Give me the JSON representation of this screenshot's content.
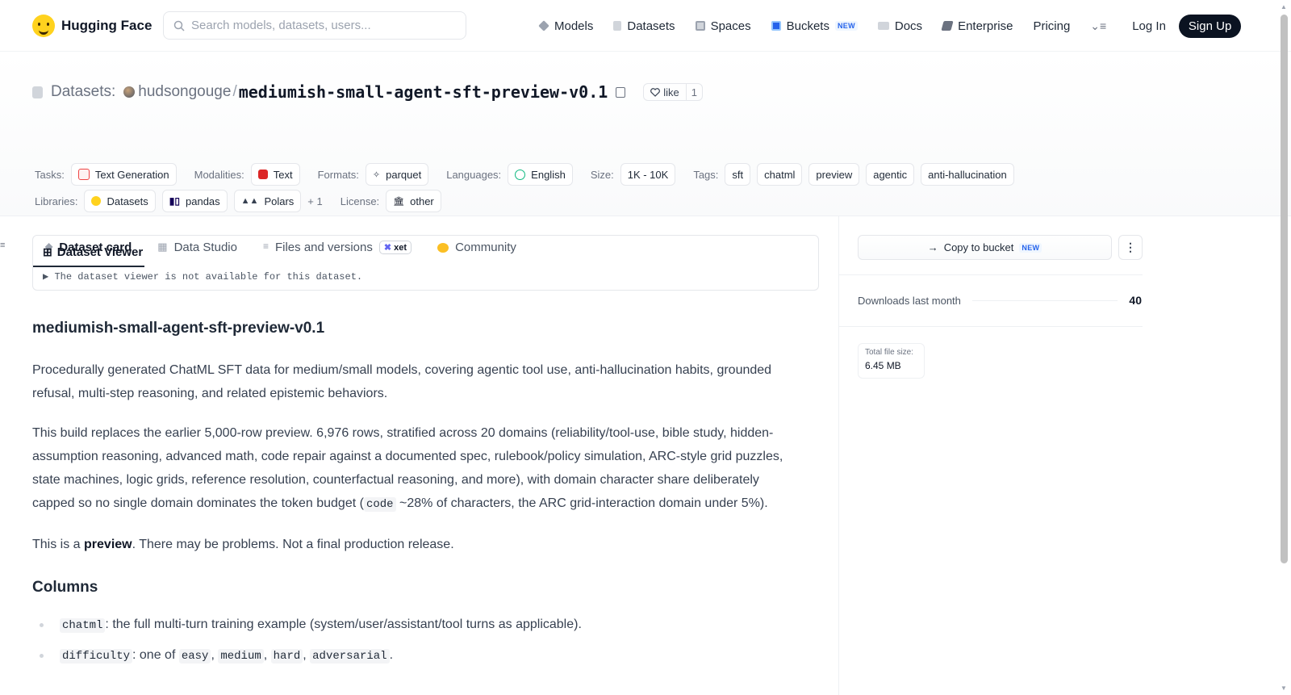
{
  "header": {
    "brand": "Hugging Face",
    "search_placeholder": "Search models, datasets, users...",
    "nav": [
      {
        "label": "Models",
        "icon": "cube-icon"
      },
      {
        "label": "Datasets",
        "icon": "database-icon"
      },
      {
        "label": "Spaces",
        "icon": "grid-icon"
      },
      {
        "label": "Buckets",
        "icon": "bucket-icon",
        "badge": "NEW"
      },
      {
        "label": "Docs",
        "icon": "book-icon"
      },
      {
        "label": "Enterprise",
        "icon": "enterprise-icon"
      },
      {
        "label": "Pricing"
      }
    ],
    "login": "Log In",
    "signup": "Sign Up"
  },
  "dataset": {
    "section": "Datasets:",
    "owner": "hudsongouge",
    "slash": "/",
    "name": "mediumish-small-agent-sft-preview-v0.1",
    "like_label": "like",
    "like_count": "1"
  },
  "meta": {
    "tasks_label": "Tasks:",
    "task": "Text Generation",
    "modalities_label": "Modalities:",
    "modality": "Text",
    "formats_label": "Formats:",
    "format": "parquet",
    "languages_label": "Languages:",
    "language": "English",
    "size_label": "Size:",
    "size": "1K - 10K",
    "tags_label": "Tags:",
    "tags": [
      "sft",
      "chatml",
      "preview",
      "agentic",
      "anti-hallucination"
    ],
    "libraries_label": "Libraries:",
    "libraries": [
      "Datasets",
      "pandas",
      "Polars"
    ],
    "libraries_more": "+ 1",
    "license_label": "License:",
    "license": "other"
  },
  "tabs": [
    {
      "label": "Dataset card",
      "active": true
    },
    {
      "label": "Data Studio"
    },
    {
      "label": "Files and versions",
      "badge": "xet"
    },
    {
      "label": "Community"
    }
  ],
  "viewer": {
    "title": "Dataset Viewer",
    "message": "The dataset viewer is not available for this dataset."
  },
  "card": {
    "title": "mediumish-small-agent-sft-preview-v0.1",
    "p1": "Procedurally generated ChatML SFT data for medium/small models, covering agentic tool use, anti-hallucination habits, grounded refusal, multi-step reasoning, and related epistemic behaviors.",
    "p2_before": "This build replaces the earlier 5,000-row preview. 6,976 rows, stratified across 20 domains (reliability/tool-use, bible study, hidden-assumption reasoning, advanced math, code repair against a documented spec, rulebook/policy simulation, ARC-style grid puzzles, state machines, logic grids, reference resolution, counterfactual reasoning, and more), with domain character share deliberately capped so no single domain dominates the token budget (",
    "p2_code": "code",
    "p2_after": " ~28% of characters, the ARC grid-interaction domain under 5%).",
    "p3_before": "This is a ",
    "p3_bold": "preview",
    "p3_after": ". There may be problems. Not a final production release.",
    "columns_title": "Columns",
    "col1_code": "chatml",
    "col1_text": ": the full multi-turn training example (system/user/assistant/tool turns as applicable).",
    "col2_code": "difficulty",
    "col2_text": ": one of ",
    "col2_vals": [
      "easy",
      "medium",
      "hard",
      "adversarial"
    ],
    "col2_sep": ", ",
    "col2_end": "."
  },
  "sidebar": {
    "copy_bucket": "Copy to bucket",
    "copy_badge": "NEW",
    "downloads_label": "Downloads last month",
    "downloads": "40",
    "filesize_label": "Total file size:",
    "filesize": "6.45 MB"
  },
  "colors": {
    "accent": "#2563eb",
    "brand_yellow": "#ffd21e",
    "dark_button": "#0b1321"
  }
}
